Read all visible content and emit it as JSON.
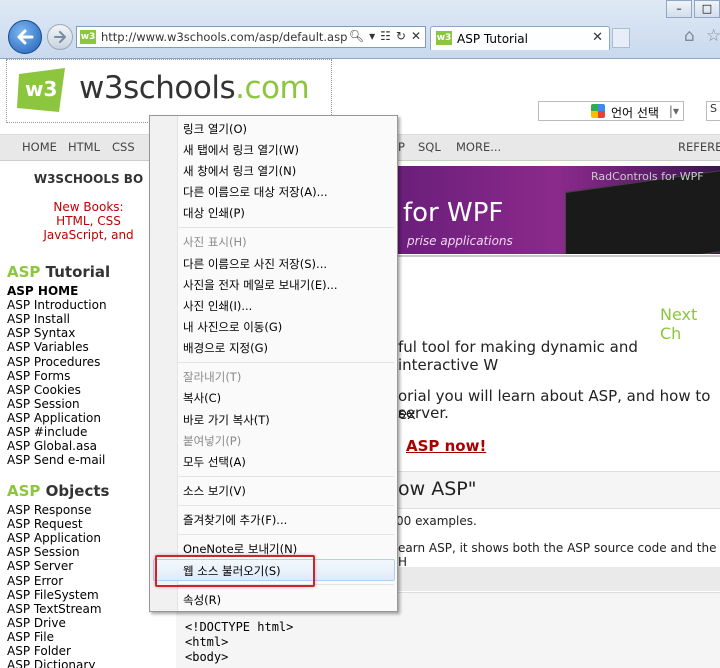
{
  "browser": {
    "url": "http://www.w3schools.com/asp/default.asp",
    "tab_title": "ASP Tutorial",
    "favicon_text": "w3"
  },
  "page": {
    "logo": {
      "main": "w3schools",
      "tld": ".com",
      "mark": "w3"
    },
    "language_select": "언어 선택",
    "search_text": "S",
    "topnav": [
      "HOME",
      "HTML",
      "CSS",
      "P",
      "SQL",
      "MORE...",
      "REFEREN"
    ],
    "books": {
      "heading": "W3SCHOOLS BO",
      "lines": [
        "New Books:",
        "HTML, CSS",
        "JavaScript, and"
      ]
    },
    "asp_tutorial": {
      "heading_prefix": "ASP",
      "heading_suffix": "Tutorial",
      "items": [
        "ASP HOME",
        "ASP Introduction",
        "ASP Install",
        "ASP Syntax",
        "ASP Variables",
        "ASP Procedures",
        "ASP Forms",
        "ASP Cookies",
        "ASP Session",
        "ASP Application",
        "ASP #include",
        "ASP Global.asa",
        "ASP Send e-mail"
      ]
    },
    "asp_objects": {
      "heading_prefix": "ASP",
      "heading_suffix": "Objects",
      "items": [
        "ASP Response",
        "ASP Request",
        "ASP Application",
        "ASP Session",
        "ASP Server",
        "ASP Error",
        "ASP FileSystem",
        "ASP TextStream",
        "ASP Drive",
        "ASP File",
        "ASP Folder",
        "ASP Dictionary"
      ]
    },
    "banner": {
      "title": "for WPF",
      "subtitle": "prise applications",
      "shot_title": "RadControls for WPF"
    },
    "next": "Next Ch",
    "main": {
      "p1": "ful tool for making dynamic and interactive W",
      "p2": "orial you will learn about ASP, and how to ex",
      "p3": "server.",
      "learn_link": "ASP now!",
      "know_heading": "ow ASP\"",
      "examples": "00 examples.",
      "learn_text": "earn ASP, it shows both the ASP source code and the H"
    },
    "code": [
      "<!DOCTYPE html>",
      "<html>",
      "<body>"
    ]
  },
  "context_menu": {
    "items": [
      {
        "label": "링크 열기(O)",
        "disabled": false
      },
      {
        "label": "새 탭에서 링크 열기(W)",
        "disabled": false
      },
      {
        "label": "새 창에서 링크 열기(N)",
        "disabled": false
      },
      {
        "label": "다른 이름으로 대상 저장(A)...",
        "disabled": false
      },
      {
        "label": "대상 인쇄(P)",
        "disabled": false
      },
      {
        "label": "사진 표시(H)",
        "disabled": true
      },
      {
        "label": "다른 이름으로 사진 저장(S)...",
        "disabled": false
      },
      {
        "label": "사진을 전자 메일로 보내기(E)...",
        "disabled": false
      },
      {
        "label": "사진 인쇄(I)...",
        "disabled": false
      },
      {
        "label": "내 사진으로 이동(G)",
        "disabled": false
      },
      {
        "label": "배경으로 지정(G)",
        "disabled": false
      },
      {
        "label": "잘라내기(T)",
        "disabled": true
      },
      {
        "label": "복사(C)",
        "disabled": false
      },
      {
        "label": "바로 가기 복사(T)",
        "disabled": false
      },
      {
        "label": "붙여넣기(P)",
        "disabled": true
      },
      {
        "label": "모두 선택(A)",
        "disabled": false
      },
      {
        "label": "소스 보기(V)",
        "disabled": false
      },
      {
        "label": "즐겨찾기에 추가(F)...",
        "disabled": false
      },
      {
        "label": "OneNote로 보내기(N)",
        "disabled": false
      },
      {
        "label": "웹 소스 불러오기(S)",
        "disabled": false
      },
      {
        "label": "속성(R)",
        "disabled": false
      }
    ]
  },
  "colors": {
    "brand_green": "#8cc63e",
    "highlight_red": "#c5272b",
    "link_red": "#aa0000"
  }
}
